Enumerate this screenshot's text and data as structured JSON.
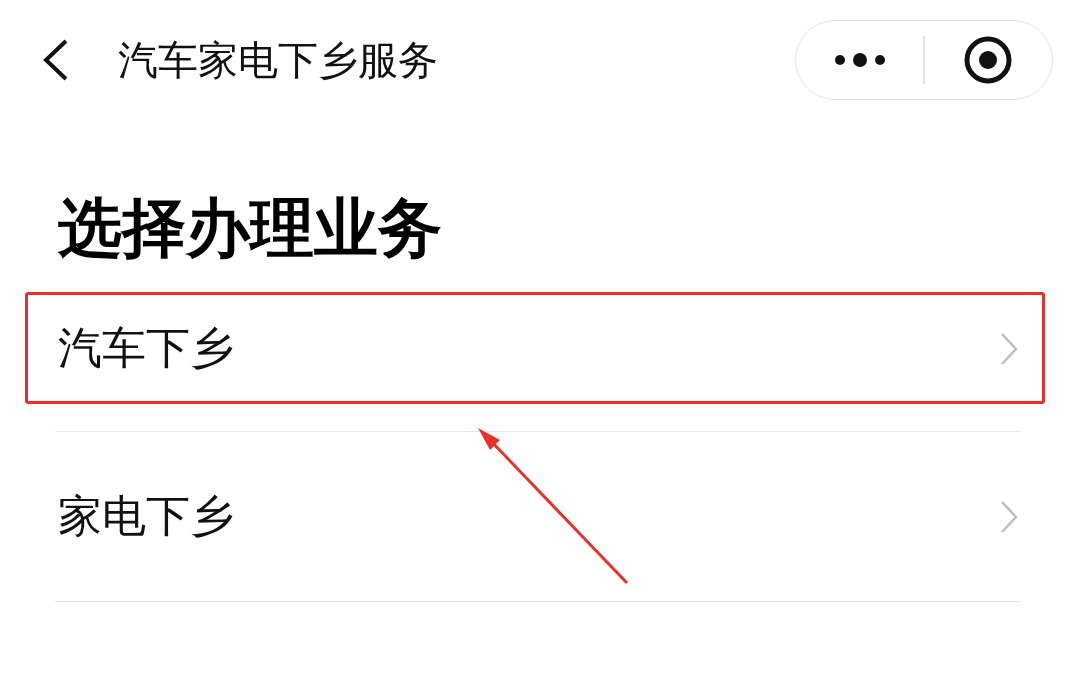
{
  "nav_bar": {
    "title": "汽车家电下乡服务"
  },
  "page": {
    "heading": "选择办理业务"
  },
  "items": [
    {
      "label": "汽车下乡",
      "highlighted": true
    },
    {
      "label": "家电下乡",
      "highlighted": false
    }
  ]
}
